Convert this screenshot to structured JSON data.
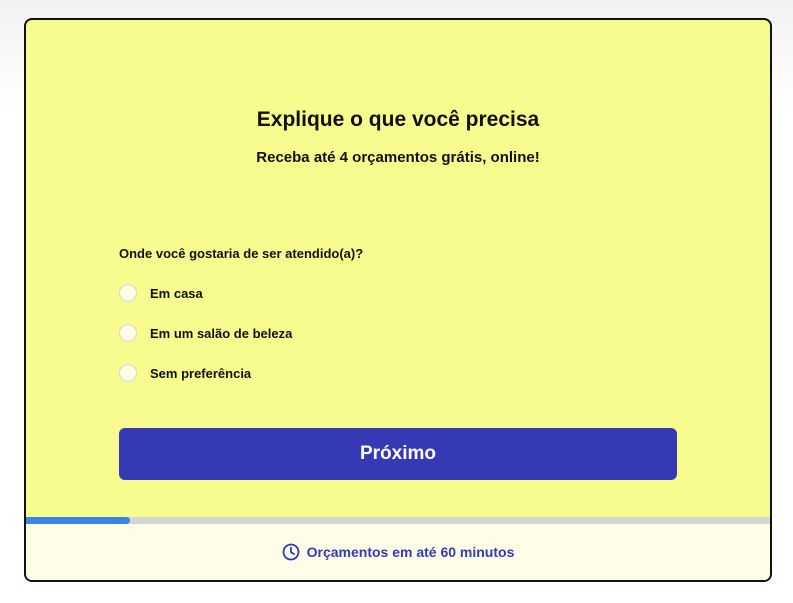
{
  "form": {
    "title": "Explique o que você precisa",
    "subtitle": "Receba até 4 orçamentos grátis, online!",
    "question": "Onde você gostaria de ser atendido(a)?",
    "options": [
      {
        "label": "Em casa",
        "selected": false
      },
      {
        "label": "Em um salão de beleza",
        "selected": false
      },
      {
        "label": "Sem preferência",
        "selected": false
      }
    ],
    "next_label": "Próximo"
  },
  "progress": {
    "fraction": 0.14
  },
  "footer": {
    "icon": "clock-icon",
    "text": "Orçamentos em até 60 minutos"
  },
  "colors": {
    "modal_bg": "#f8fb8e",
    "button": "#3539b3",
    "progress": "#3b82e6",
    "footer_text": "#3539b3"
  }
}
